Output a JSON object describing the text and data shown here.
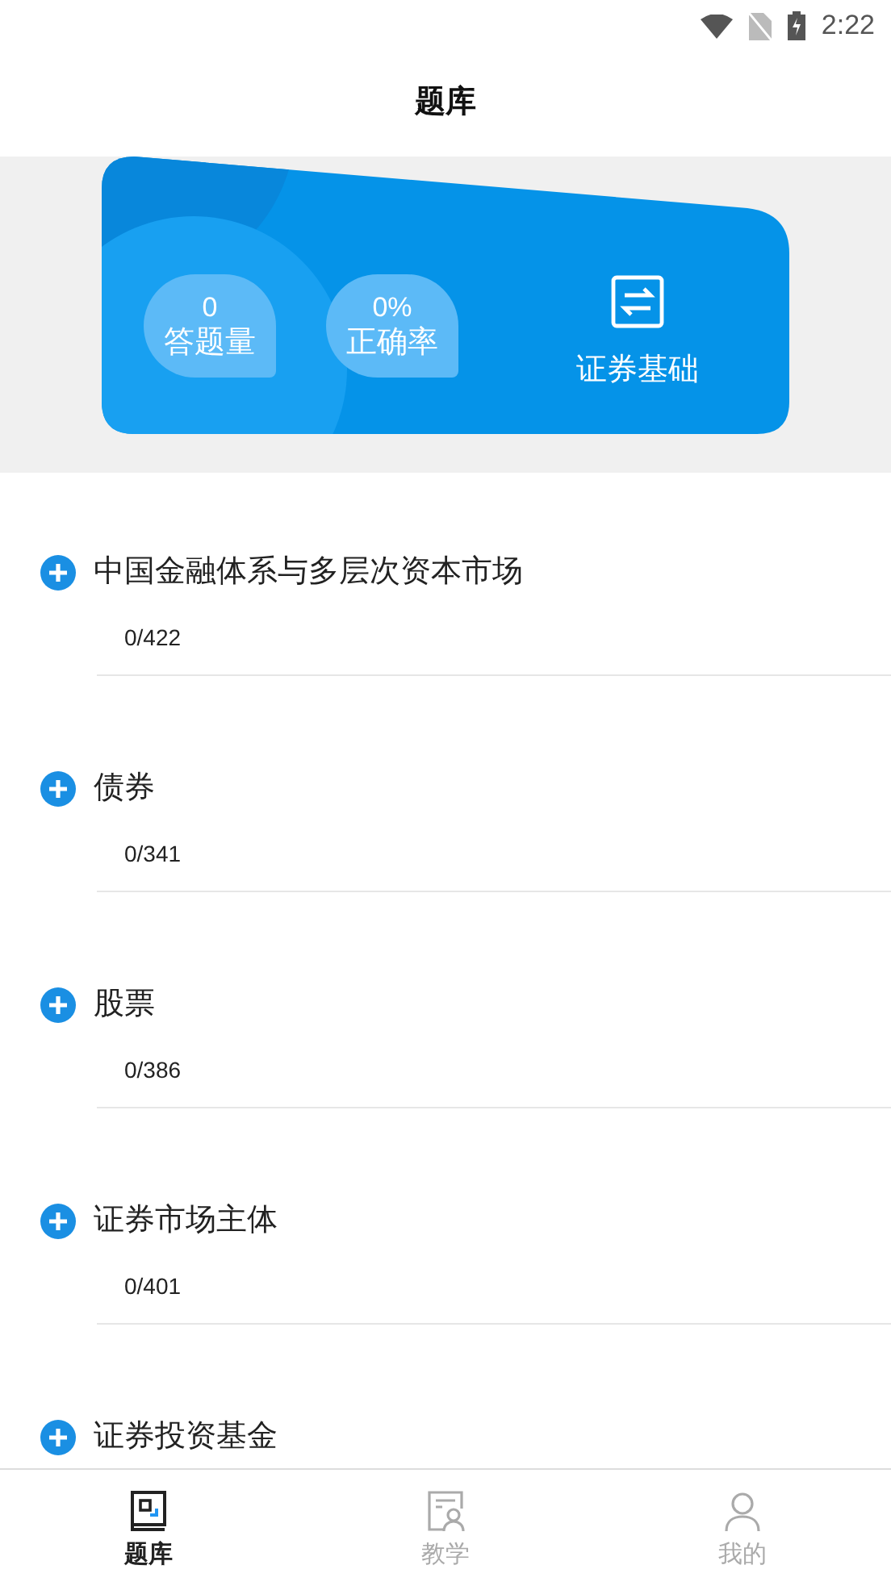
{
  "status_bar": {
    "time": "2:22"
  },
  "header": {
    "title": "题库"
  },
  "summary": {
    "stats": [
      {
        "value": "0",
        "label": "答题量"
      },
      {
        "value": "0%",
        "label": "正确率"
      }
    ],
    "subject": "证券基础"
  },
  "chapters": [
    {
      "title": "中国金融体系与多层次资本市场",
      "progress": "0/422"
    },
    {
      "title": "债券",
      "progress": "0/341"
    },
    {
      "title": "股票",
      "progress": "0/386"
    },
    {
      "title": "证券市场主体",
      "progress": "0/401"
    },
    {
      "title": "证券投资基金"
    }
  ],
  "tabs": [
    {
      "label": "题库",
      "kind": "bank",
      "selected": true
    },
    {
      "label": "教学",
      "kind": "teach",
      "selected": false
    },
    {
      "label": "我的",
      "kind": "me",
      "selected": false
    }
  ]
}
